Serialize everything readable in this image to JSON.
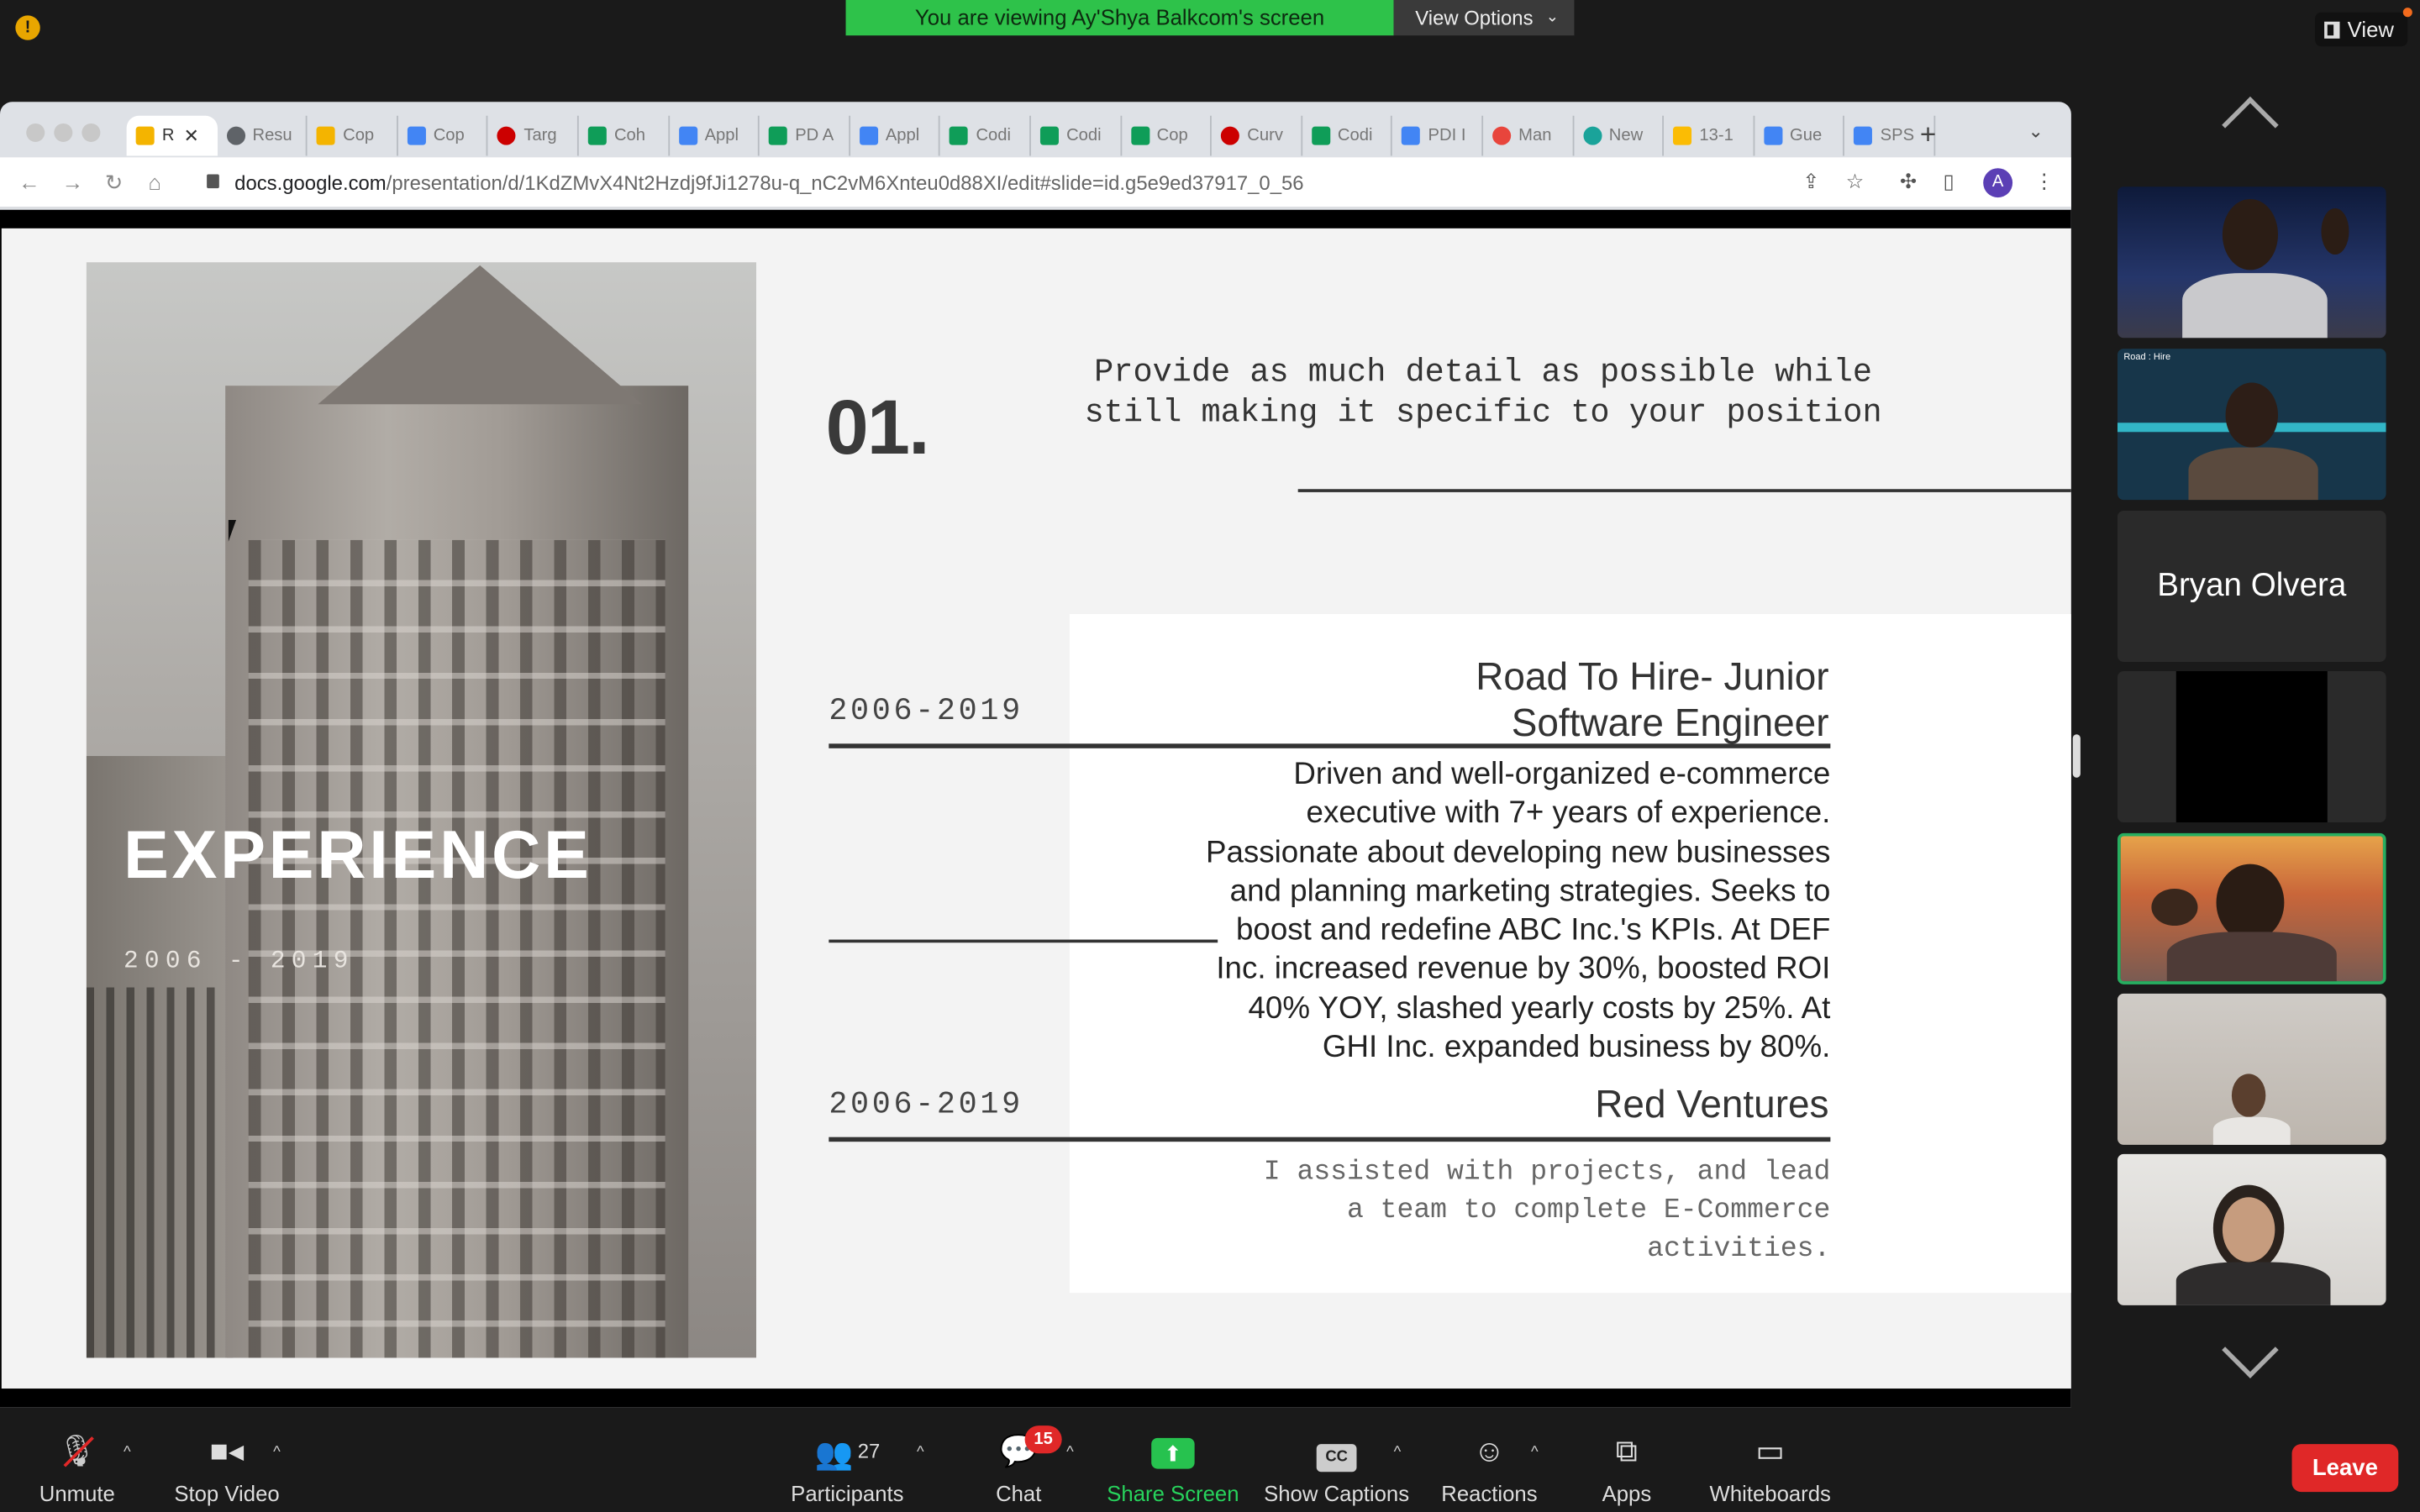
{
  "banner": {
    "sharing_text": "You are viewing Ay'Shya Balkcom's screen",
    "view_options_label": "View Options",
    "view_label": "View"
  },
  "browser": {
    "tabs": [
      {
        "label": "R",
        "favicon": "slides-yellow",
        "color": "#f4b400"
      },
      {
        "label": "Resu",
        "favicon": "globe",
        "color": "#5f6368"
      },
      {
        "label": "Cop",
        "favicon": "slides-yellow",
        "color": "#f4b400"
      },
      {
        "label": "Cop",
        "favicon": "docs-blue",
        "color": "#4285f4"
      },
      {
        "label": "Targ",
        "favicon": "target-red",
        "color": "#cc0000"
      },
      {
        "label": "Coh",
        "favicon": "sheets-green",
        "color": "#0f9d58"
      },
      {
        "label": "Appl",
        "favicon": "docs-blue",
        "color": "#4285f4"
      },
      {
        "label": "PD A",
        "favicon": "sheets-green",
        "color": "#0f9d58"
      },
      {
        "label": "Appl",
        "favicon": "docs-blue",
        "color": "#4285f4"
      },
      {
        "label": "Codi",
        "favicon": "sheets-green",
        "color": "#0f9d58"
      },
      {
        "label": "Codi",
        "favicon": "sheets-green",
        "color": "#0f9d58"
      },
      {
        "label": "Cop",
        "favicon": "sheets-green",
        "color": "#0f9d58"
      },
      {
        "label": "Curv",
        "favicon": "target-red",
        "color": "#cc0000"
      },
      {
        "label": "Codi",
        "favicon": "sheets-green",
        "color": "#0f9d58"
      },
      {
        "label": "PDI I",
        "favicon": "docs-blue",
        "color": "#4285f4"
      },
      {
        "label": "Man",
        "favicon": "star-red",
        "color": "#e8453c"
      },
      {
        "label": "New",
        "favicon": "circle-teal",
        "color": "#1aa39a"
      },
      {
        "label": "13-1",
        "favicon": "drive",
        "color": "#fbbc04"
      },
      {
        "label": "Gue",
        "favicon": "docs-blue",
        "color": "#4285f4"
      },
      {
        "label": "SPS",
        "favicon": "docs-blue",
        "color": "#4285f4"
      }
    ],
    "url_host": "docs.google.com",
    "url_path": "/presentation/d/1KdZMvX4Nt2Hzdj9fJi1278u-q_nC2vM6Xnteu0d88XI/edit#slide=id.g5e9ed37917_0_56",
    "profile_initial": "A"
  },
  "slide": {
    "panel_title": "EXPERIENCE",
    "panel_years": "2006 - 2019",
    "number": "01.",
    "intro_line1": "Provide as much detail as possible while",
    "intro_line2": "still making it specific to your position",
    "entry1_year": "2006-2019",
    "entry1_title_line1": "Road To Hire- Junior",
    "entry1_title_line2": "Software Engineer",
    "entry1_desc": [
      "Driven and well-organized e-commerce",
      "executive with 7+ years of experience.",
      "Passionate about developing new businesses",
      "and planning marketing strategies. Seeks to",
      "boost and redefine ABC Inc.'s KPIs. At DEF",
      "Inc. increased revenue by 30%, boosted ROI",
      "40% YOY, slashed yearly costs by 25%. At",
      "GHI Inc. expanded business by 80%."
    ],
    "entry2_year": "2006-2019",
    "entry2_title": "Red Ventures",
    "entry2_desc": [
      "I assisted with projects, and lead",
      "a team to complete E-Commerce",
      "activities."
    ]
  },
  "participants_panel": {
    "name_tile": "Bryan Olvera",
    "mini_label": "Road : Hire"
  },
  "controls": {
    "unmute": "Unmute",
    "stop_video": "Stop Video",
    "participants": "Participants",
    "participants_count": "27",
    "chat": "Chat",
    "chat_badge": "15",
    "share_screen": "Share Screen",
    "show_captions": "Show Captions",
    "captions_icon": "CC",
    "reactions": "Reactions",
    "apps": "Apps",
    "whiteboards": "Whiteboards",
    "leave": "Leave"
  }
}
